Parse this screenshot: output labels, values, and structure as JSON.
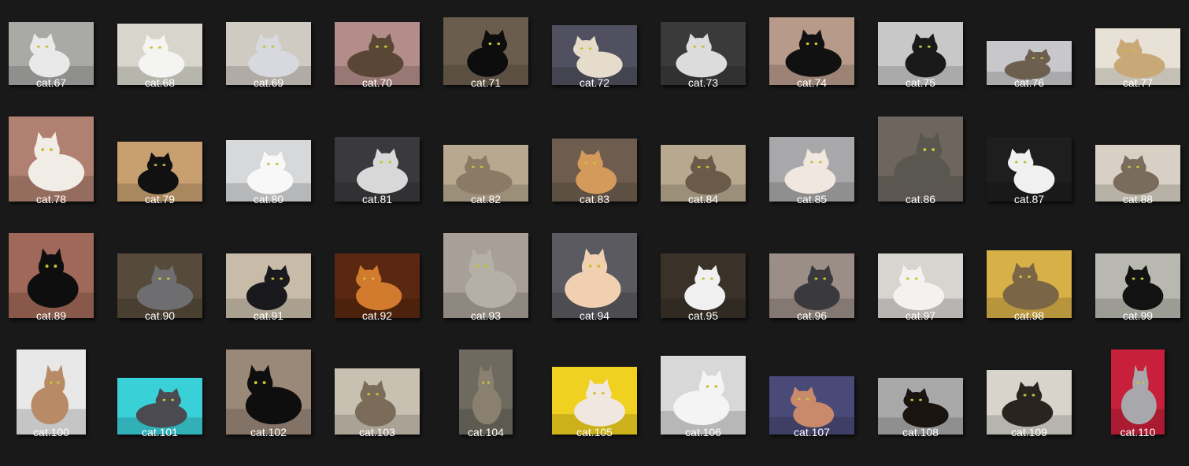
{
  "files": [
    {
      "name": "cat.67",
      "bg": "#a9a9a6",
      "fg": "#e9e9e9"
    },
    {
      "name": "cat.68",
      "bg": "#d8d6cc",
      "fg": "#f4f4f2"
    },
    {
      "name": "cat.69",
      "bg": "#cfcac2",
      "fg": "#d8d9de"
    },
    {
      "name": "cat.70",
      "bg": "#b38d89",
      "fg": "#5a4634"
    },
    {
      "name": "cat.71",
      "bg": "#6b5d4d",
      "fg": "#0d0d0d"
    },
    {
      "name": "cat.72",
      "bg": "#505060",
      "fg": "#e6dccb"
    },
    {
      "name": "cat.73",
      "bg": "#3a3a3a",
      "fg": "#dcdcdc"
    },
    {
      "name": "cat.74",
      "bg": "#b89a8a",
      "fg": "#111111"
    },
    {
      "name": "cat.75",
      "bg": "#c8c8c8",
      "fg": "#1a1a1a"
    },
    {
      "name": "cat.76",
      "bg": "#c8c8cc",
      "fg": "#6d5f50"
    },
    {
      "name": "cat.77",
      "bg": "#e8e2d6",
      "fg": "#c9a878"
    },
    {
      "name": "cat.78",
      "bg": "#b08070",
      "fg": "#f2ece6"
    },
    {
      "name": "cat.79",
      "bg": "#c8a070",
      "fg": "#111111"
    },
    {
      "name": "cat.80",
      "bg": "#d6d8da",
      "fg": "#f8f8f8"
    },
    {
      "name": "cat.81",
      "bg": "#3a3a3e",
      "fg": "#d8d8d8"
    },
    {
      "name": "cat.82",
      "bg": "#b8a890",
      "fg": "#8a7a66"
    },
    {
      "name": "cat.83",
      "bg": "#6e5d4e",
      "fg": "#d49a5c"
    },
    {
      "name": "cat.84",
      "bg": "#b8a890",
      "fg": "#6a5a4a"
    },
    {
      "name": "cat.85",
      "bg": "#a8a8aa",
      "fg": "#f0e8e0"
    },
    {
      "name": "cat.86",
      "bg": "#6e665e",
      "fg": "#5a5650"
    },
    {
      "name": "cat.87",
      "bg": "#1e1e1e",
      "fg": "#f0f0f0"
    },
    {
      "name": "cat.88",
      "bg": "#d8d0c4",
      "fg": "#7a6c5c"
    },
    {
      "name": "cat.89",
      "bg": "#a06858",
      "fg": "#0e0e0e"
    },
    {
      "name": "cat.90",
      "bg": "#564a3a",
      "fg": "#6e6e70"
    },
    {
      "name": "cat.91",
      "bg": "#c8bca8",
      "fg": "#1a1a1e"
    },
    {
      "name": "cat.92",
      "bg": "#5a2810",
      "fg": "#d27a2e"
    },
    {
      "name": "cat.93",
      "bg": "#a8a098",
      "fg": "#b4b0a8"
    },
    {
      "name": "cat.94",
      "bg": "#5a5a60",
      "fg": "#f0d0b0"
    },
    {
      "name": "cat.95",
      "bg": "#3a3228",
      "fg": "#f0f0f0"
    },
    {
      "name": "cat.96",
      "bg": "#9a8e86",
      "fg": "#3a3a3e"
    },
    {
      "name": "cat.97",
      "bg": "#d8d4d0",
      "fg": "#f4f2f0"
    },
    {
      "name": "cat.98",
      "bg": "#d8b048",
      "fg": "#7a6646"
    },
    {
      "name": "cat.99",
      "bg": "#b8b8b0",
      "fg": "#121212"
    },
    {
      "name": "cat.100",
      "bg": "#e8e8e8",
      "fg": "#b88a66"
    },
    {
      "name": "cat.101",
      "bg": "#3ad0d8",
      "fg": "#4a4a50"
    },
    {
      "name": "cat.102",
      "bg": "#9a8878",
      "fg": "#0e0e0e"
    },
    {
      "name": "cat.103",
      "bg": "#c8c0b0",
      "fg": "#7a6c58"
    },
    {
      "name": "cat.104",
      "bg": "#6e6a60",
      "fg": "#8a8070"
    },
    {
      "name": "cat.105",
      "bg": "#f0d020",
      "fg": "#f0e8e0"
    },
    {
      "name": "cat.106",
      "bg": "#d8d8d8",
      "fg": "#f4f4f4"
    },
    {
      "name": "cat.107",
      "bg": "#4a4a78",
      "fg": "#c88a6a"
    },
    {
      "name": "cat.108",
      "bg": "#a8a8a8",
      "fg": "#1a1410"
    },
    {
      "name": "cat.109",
      "bg": "#d8d4cc",
      "fg": "#2a2420"
    },
    {
      "name": "cat.110",
      "bg": "#c8203a",
      "fg": "#a8a8ac"
    }
  ]
}
